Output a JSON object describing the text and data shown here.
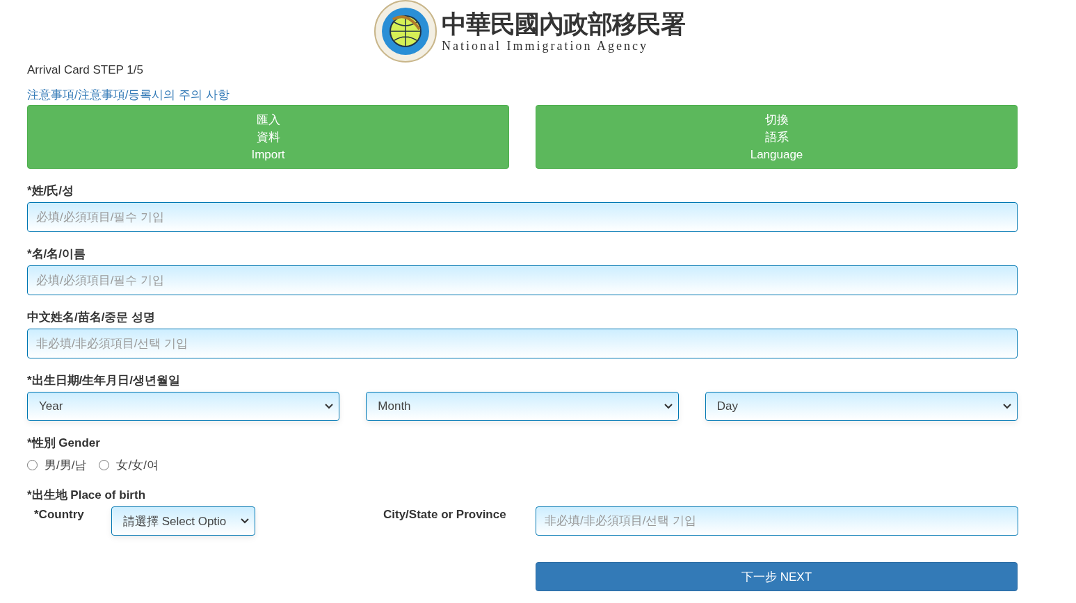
{
  "header": {
    "title_zh": "中華民國內政部移民署",
    "title_en": "National Immigration Agency"
  },
  "step": "Arrival Card STEP 1/5",
  "notice_link": "注意事項/注意事項/등록시의 주의 사항",
  "actions": [
    {
      "lines": [
        "匯入",
        "資料",
        "Import"
      ]
    },
    {
      "lines": [
        "切換",
        "語系",
        "Language"
      ]
    }
  ],
  "fields": [
    {
      "label": "*姓/氏/성",
      "placeholder": "必填/必須項目/필수 기입"
    },
    {
      "label": "*名/名/이름",
      "placeholder": "必填/必須項目/필수 기입"
    },
    {
      "label": "中文姓名/苗名/중문 성명",
      "placeholder": "非必填/非必須項目/선택 기입"
    }
  ],
  "birth_date": {
    "label": "*出生日期/生年月日/생년월일",
    "selects": [
      "Year",
      "Month",
      "Day"
    ]
  },
  "gender": {
    "label": "*性別 Gender",
    "options": [
      {
        "label": "男/男/남",
        "selected": false
      },
      {
        "label": "女/女/여",
        "selected": false
      }
    ]
  },
  "place_of_birth": {
    "label": "*出生地 Place of birth",
    "country_label": "*Country",
    "country_value": "請選擇 Select Optio",
    "city_label": "City/State or Province",
    "city_placeholder": "非必填/非必須項目/선택 기입"
  },
  "next_button": "下一步 NEXT"
}
